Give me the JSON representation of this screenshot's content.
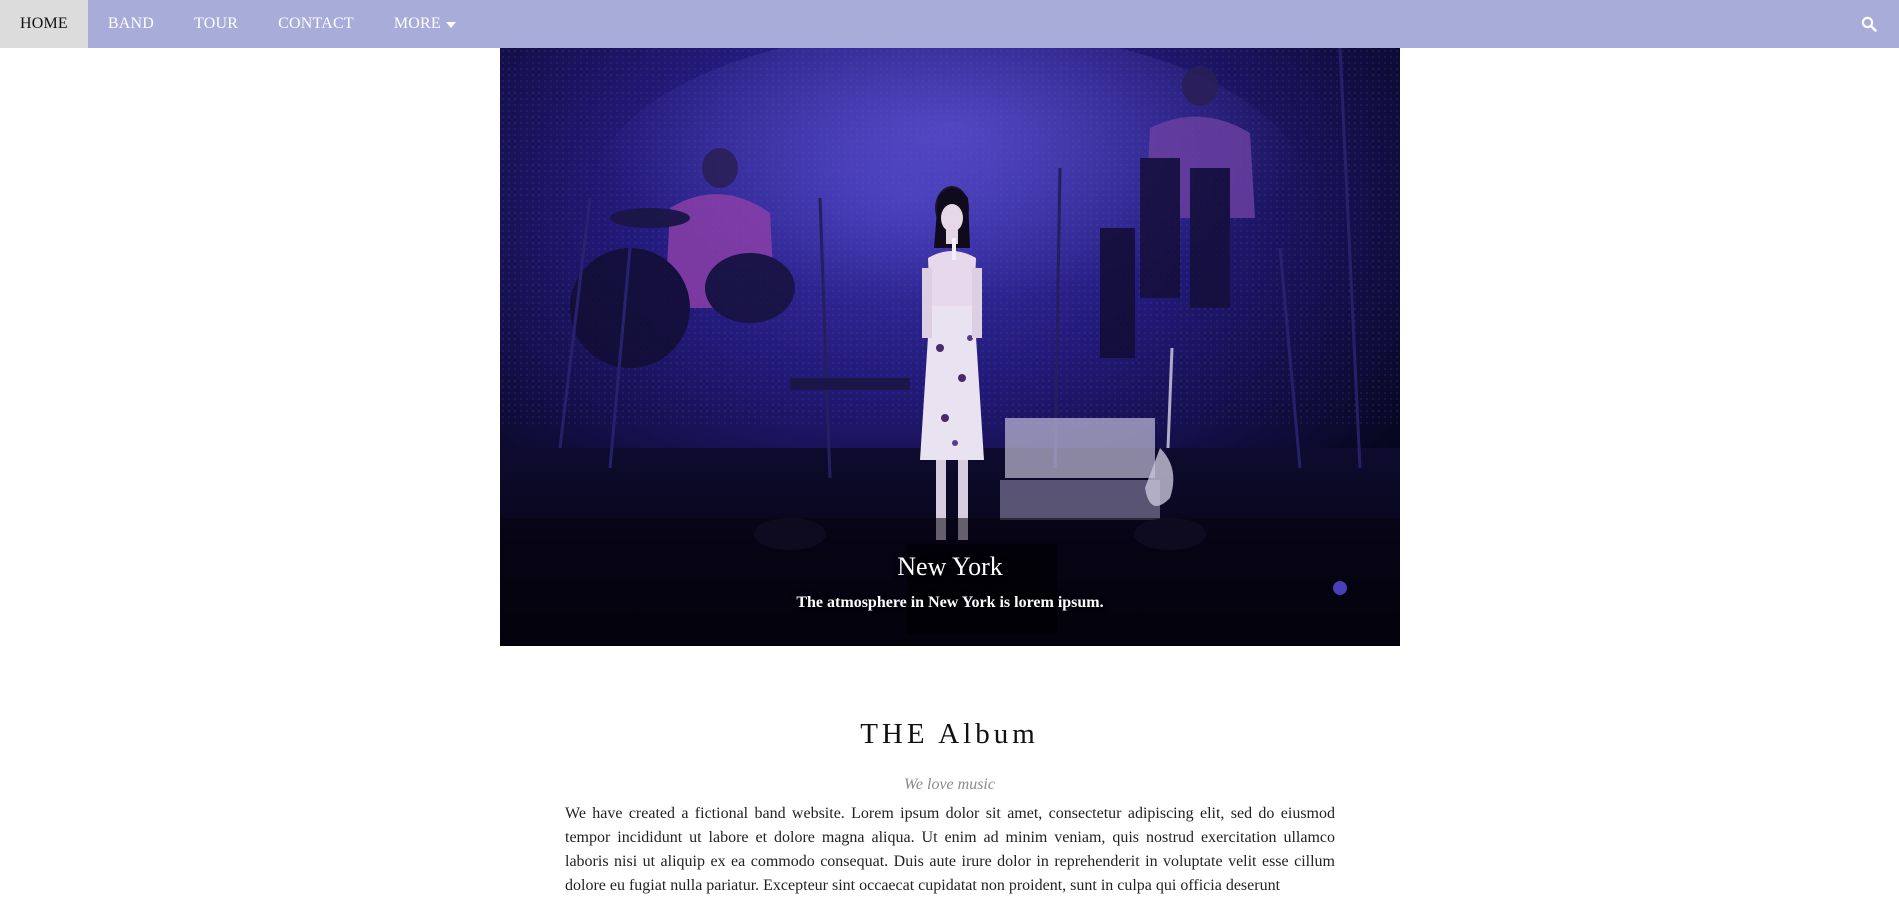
{
  "nav": {
    "items": [
      {
        "label": "HOME",
        "active": true
      },
      {
        "label": "BAND",
        "active": false
      },
      {
        "label": "TOUR",
        "active": false
      },
      {
        "label": "CONTACT",
        "active": false
      },
      {
        "label": "MORE",
        "active": false,
        "dropdown": true
      }
    ],
    "search_icon": "search-icon",
    "background_color": "#a8acd9",
    "active_color": "#dcdcdc"
  },
  "hero": {
    "title": "New York",
    "caption": "The atmosphere in New York is lorem ipsum."
  },
  "album": {
    "title": "THE Album",
    "subtitle": "We love music",
    "body": "We have created a fictional band website. Lorem ipsum dolor sit amet, consectetur adipiscing elit, sed do eiusmod tempor incididunt ut labore et dolore magna aliqua. Ut enim ad minim veniam, quis nostrud exercitation ullamco laboris nisi ut aliquip ex ea commodo consequat. Duis aute irure dolor in reprehenderit in voluptate velit esse cillum dolore eu fugiat nulla pariatur. Excepteur sint occaecat cupidatat non proident, sunt in culpa qui officia deserunt"
  }
}
